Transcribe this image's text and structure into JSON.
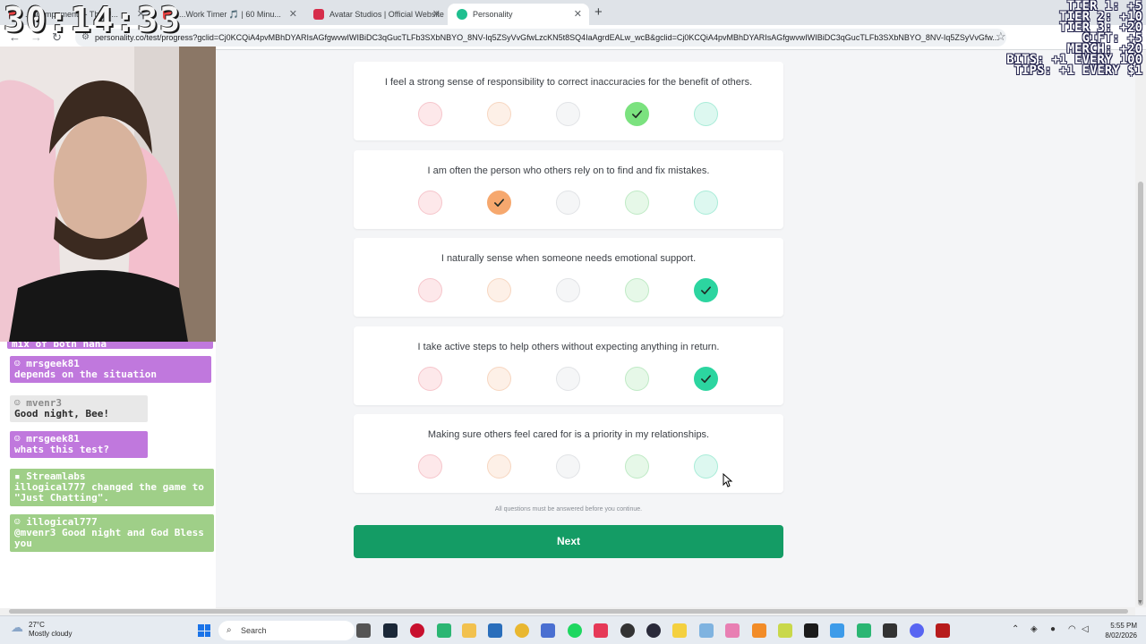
{
  "browser": {
    "tabs": [
      {
        "title": "...ncampaments - The U..."
      },
      {
        "title": "...Work Timer 🎵 | 60 Minu..."
      },
      {
        "title": "Avatar Studios | Official Website"
      },
      {
        "title": "Personality"
      }
    ],
    "url": "personality.co/test/progress?gclid=Cj0KCQiA4pvMBhDYARIsAGfgwvwIWIBiDC3qGucTLFb3SXbNBYO_8NV-Iq5ZSyVvGfwLzcKN5t8SQ4IaAgrdEALw_wcB&gclid=Cj0KCQiA4pvMBhDYARIsAGfgwvwIWIBiDC3qGucTLFb3SXbNBYO_8NV-Iq5ZSyVvGfw..."
  },
  "test": {
    "questions": [
      {
        "text": "I feel a strong sense of responsibility to correct inaccuracies for the benefit of others.",
        "selected": 4
      },
      {
        "text": "I am often the person who others rely on to find and fix mistakes.",
        "selected": 2
      },
      {
        "text": "I naturally sense when someone needs emotional support.",
        "selected": 5
      },
      {
        "text": "I take active steps to help others without expecting anything in return.",
        "selected": 5
      },
      {
        "text": "Making sure others feel cared for is a priority in my relationships.",
        "selected": 0
      }
    ],
    "notice": "All questions must be answered before you continue.",
    "next_label": "Next"
  },
  "overlay": {
    "timer": "30:14:33",
    "tiers": [
      "TIER 1: +5",
      "TIER 2: +10",
      "TIER 3: +20",
      "GIFT: +5",
      "MERCH: +20",
      "BITS: +1 EVERY 100",
      "TIPS: +1 EVERY $1"
    ]
  },
  "chat": [
    {
      "user": "",
      "text": "mix of both haha"
    },
    {
      "user": "mrsgeek81",
      "text": "depends on the situation"
    },
    {
      "user": "mvenr3",
      "text": "Good night, Bee!"
    },
    {
      "user": "mrsgeek81",
      "text": "whats this test?"
    },
    {
      "user": "Streamlabs",
      "text": "illogical777 changed the game to \"Just Chatting\"."
    },
    {
      "user": "illogical777",
      "text": "@mvenr3 Good night and God Bless you"
    }
  ],
  "taskbar": {
    "weather_temp": "27°C",
    "weather_desc": "Mostly cloudy",
    "search_placeholder": "Search",
    "time": "5:55 PM",
    "date": "8/02/2026"
  }
}
